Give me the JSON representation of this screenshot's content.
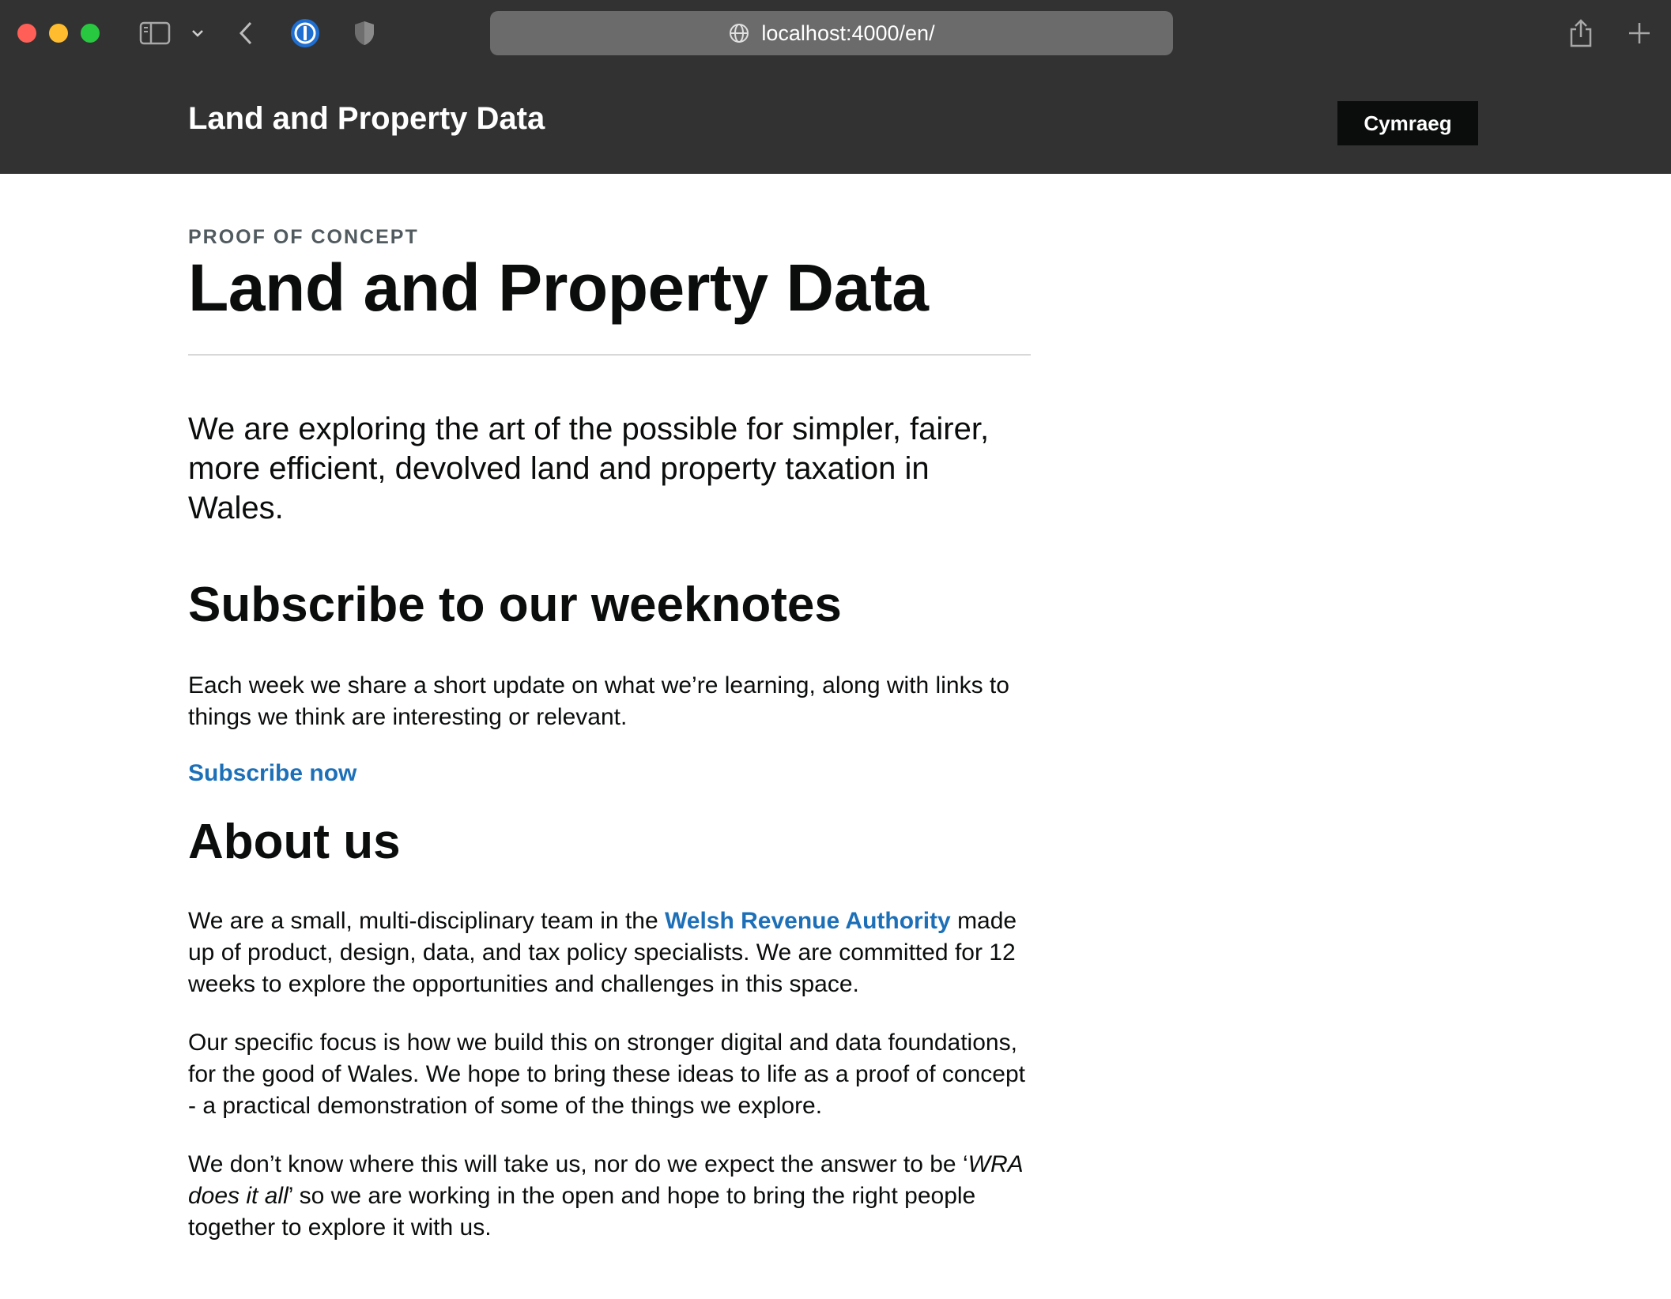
{
  "browser": {
    "url": "localhost:4000/en/",
    "icons": [
      "sidebar-icon",
      "chevron-down-icon",
      "back-icon",
      "password-manager-icon",
      "shield-icon",
      "globe-icon",
      "share-icon",
      "new-tab-icon"
    ]
  },
  "header": {
    "title": "Land and Property Data",
    "language_button": "Cymraeg"
  },
  "hero": {
    "caption": "PROOF OF CONCEPT",
    "title": "Land and Property Data",
    "lead": "We are exploring the art of the possible for simpler, fairer, more efficient, devolved land and property taxation in Wales."
  },
  "subscribe": {
    "heading": "Subscribe to our weeknotes",
    "body": "Each week we share a short update on what we’re learning, along with links to things we think are interesting or relevant.",
    "link": "Subscribe now"
  },
  "about": {
    "heading": "About us",
    "p1_before": "We are a small, multi-disciplinary team in the ",
    "p1_link": "Welsh Revenue Authority",
    "p1_after": " made up of product, design, data, and tax policy specialists. We are committed for 12 weeks to explore the opportunities and challenges in this space.",
    "p2": "Our specific focus is how we build this on stronger digital and data foundations, for the good of Wales. We hope to bring these ideas to life as a proof of concept - a practical demonstration of some of the things we explore.",
    "p3_before": "We don’t know where this will take us, nor do we expect the answer to be ‘",
    "p3_em": "WRA does it all",
    "p3_after": "’ so we are working in the open and hope to bring the right people together to explore it with us."
  },
  "colors": {
    "header_bg": "#323232",
    "link": "#1d70b8",
    "text": "#0b0c0c",
    "caption": "#505a5f"
  }
}
